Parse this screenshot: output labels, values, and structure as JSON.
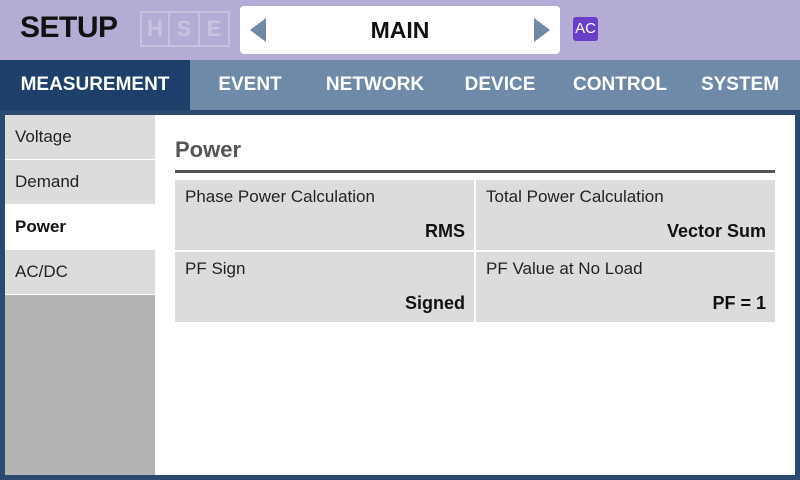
{
  "header": {
    "title": "SETUP",
    "hse": [
      "H",
      "S",
      "E"
    ],
    "page_name": "MAIN",
    "badge": "AC"
  },
  "tabs": [
    {
      "label": "MEASUREMENT",
      "active": true
    },
    {
      "label": "EVENT",
      "active": false
    },
    {
      "label": "NETWORK",
      "active": false
    },
    {
      "label": "DEVICE",
      "active": false
    },
    {
      "label": "CONTROL",
      "active": false
    },
    {
      "label": "SYSTEM",
      "active": false
    }
  ],
  "sidebar": {
    "items": [
      {
        "label": "Voltage",
        "active": false
      },
      {
        "label": "Demand",
        "active": false
      },
      {
        "label": "Power",
        "active": true
      },
      {
        "label": "AC/DC",
        "active": false
      }
    ]
  },
  "main": {
    "section_title": "Power",
    "settings": [
      {
        "label": "Phase Power Calculation",
        "value": "RMS"
      },
      {
        "label": "Total Power Calculation",
        "value": "Vector Sum"
      },
      {
        "label": "PF Sign",
        "value": "Signed"
      },
      {
        "label": "PF Value at No Load",
        "value": "PF = 1"
      }
    ]
  },
  "colors": {
    "header_bg": "#b4acd4",
    "tab_bar": "#6e8aa8",
    "tab_active": "#1f3f6b",
    "frame": "#2b4a70",
    "badge": "#6a3fc8"
  }
}
